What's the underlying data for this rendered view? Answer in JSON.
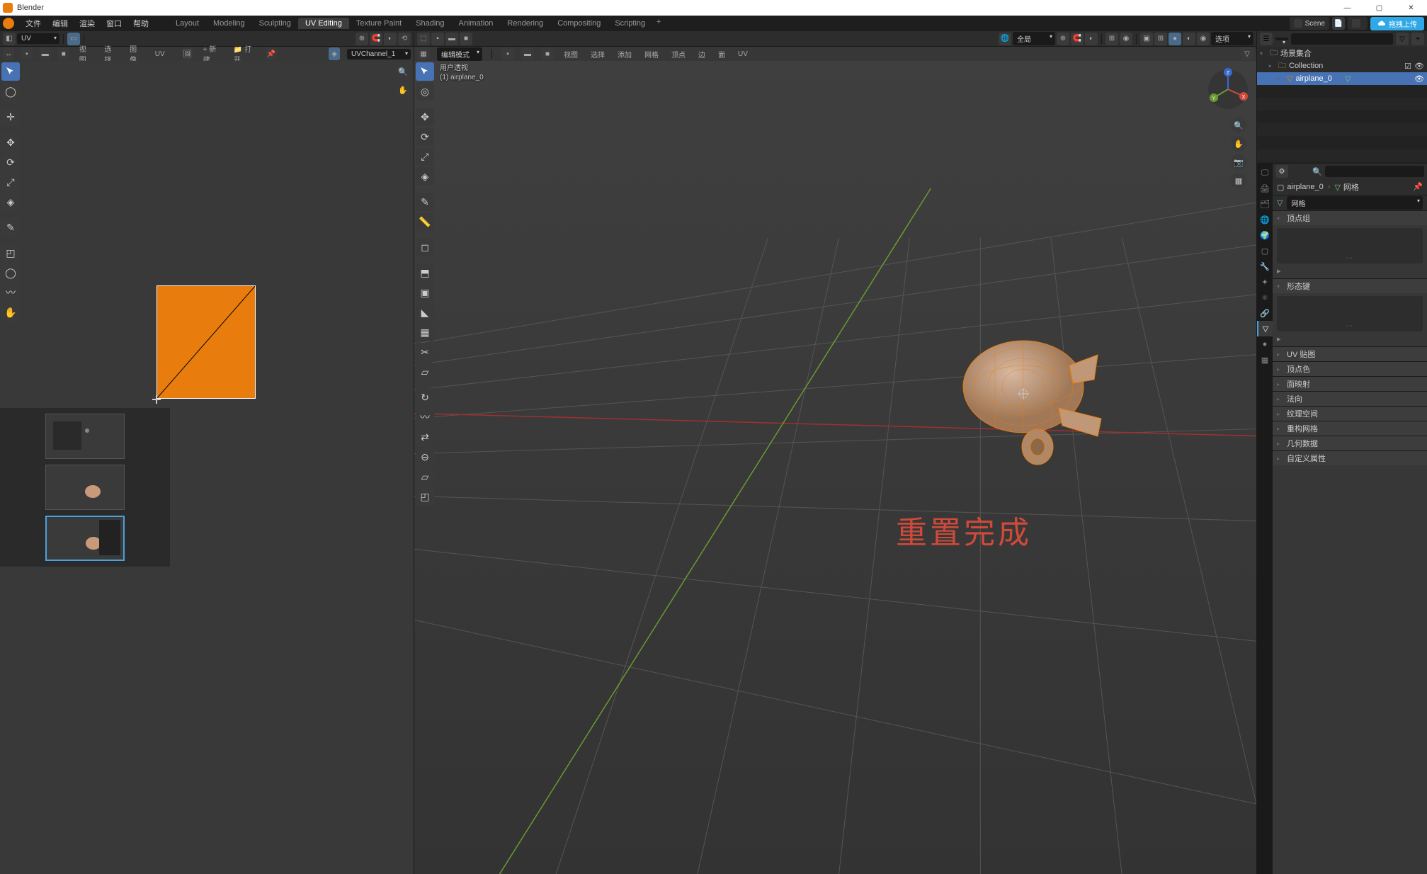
{
  "app_title": "Blender",
  "win_controls": {
    "min": "—",
    "max": "▢",
    "close": "✕"
  },
  "main_menu": [
    "文件",
    "编辑",
    "渲染",
    "窗口",
    "帮助"
  ],
  "workspaces": [
    "Layout",
    "Modeling",
    "Sculpting",
    "UV Editing",
    "Texture Paint",
    "Shading",
    "Animation",
    "Rendering",
    "Compositing",
    "Scripting"
  ],
  "active_workspace": "UV Editing",
  "scene_label": "Scene",
  "upload_label": "拖拽上传",
  "uv_editor": {
    "mode": "UV",
    "sync_label": "UV",
    "header_menu": [
      "视图",
      "选择",
      "图像",
      "UV"
    ],
    "new_btn": "+ 新建",
    "open_btn": "📁 打开",
    "channel": "UVChannel_1"
  },
  "viewport": {
    "mode_label": "编辑模式",
    "header_menu": [
      "视图",
      "选择",
      "添加",
      "网格",
      "顶点",
      "边",
      "面",
      "UV"
    ],
    "global_label": "全局",
    "options_label": "选项",
    "info_line1": "用户透视",
    "info_line2": "(1) airplane_0",
    "overlay_text": "重置完成",
    "axes": {
      "x": "X",
      "y": "Y",
      "z": "Z"
    }
  },
  "outliner": {
    "scene_collection": "场景集合",
    "collection": "Collection",
    "object": "airplane_0"
  },
  "properties": {
    "search_placeholder": "",
    "breadcrumb_obj": "airplane_0",
    "breadcrumb_mesh": "网格",
    "mesh_name": "网格",
    "sections": {
      "vertex_groups": "顶点组",
      "shape_keys": "形态键",
      "uv_maps": "UV 贴图",
      "vertex_colors": "顶点色",
      "face_maps": "面映射",
      "normals": "法向",
      "texture_space": "纹理空间",
      "remesh": "重构网格",
      "geometry_data": "几何数据",
      "custom_props": "自定义属性"
    }
  },
  "colors": {
    "accent_orange": "#e87d0d",
    "selection_blue": "#4772b3",
    "upload_blue": "#2ea8e6",
    "overlay_red": "#d04a3a"
  }
}
